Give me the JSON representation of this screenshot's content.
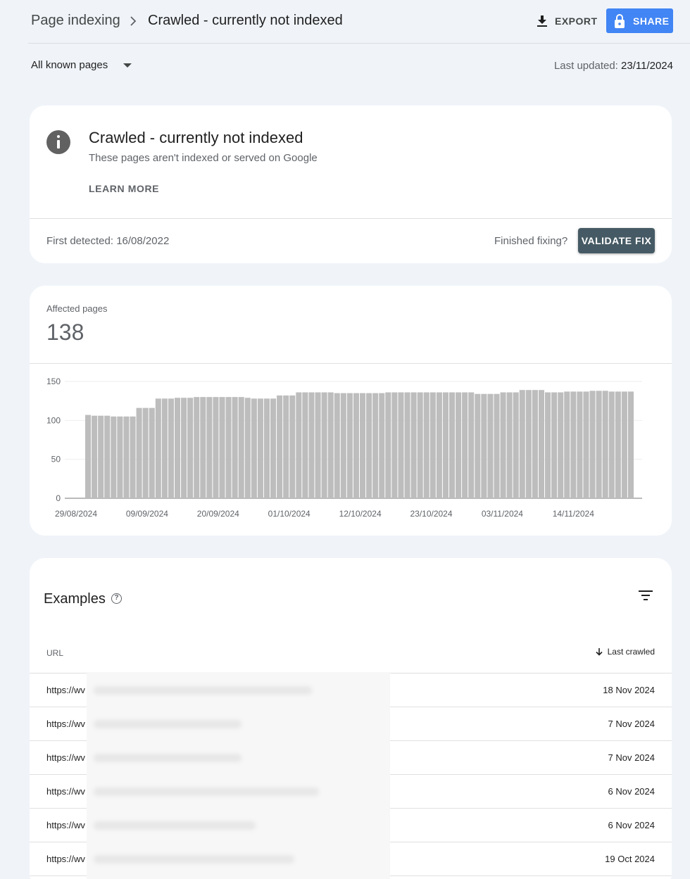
{
  "breadcrumb": {
    "root": "Page indexing",
    "current": "Crawled - currently not indexed"
  },
  "toolbar": {
    "export_label": "EXPORT",
    "share_label": "SHARE"
  },
  "filter": {
    "selected": "All known pages",
    "last_updated_label": "Last updated:",
    "last_updated_value": "23/11/2024"
  },
  "issue": {
    "title": "Crawled - currently not indexed",
    "description": "These pages aren't indexed or served on Google",
    "learn_more": "LEARN MORE",
    "first_detected": "First detected: 16/08/2022",
    "finished_fixing": "Finished fixing?",
    "validate_label": "VALIDATE FIX"
  },
  "affected": {
    "label": "Affected pages",
    "value": "138"
  },
  "chart_data": {
    "type": "bar",
    "title": "",
    "xlabel": "",
    "ylabel": "",
    "ylim": [
      0,
      150
    ],
    "yticks": [
      0,
      50,
      100,
      150
    ],
    "grid": true,
    "xtick_labels": [
      "29/08/2024",
      "09/09/2024",
      "20/09/2024",
      "01/10/2024",
      "12/10/2024",
      "23/10/2024",
      "03/11/2024",
      "14/11/2024"
    ],
    "color": "#bdbdbd",
    "series": [
      {
        "values": [
          107,
          106,
          106,
          106,
          105,
          105,
          105,
          105,
          116,
          116,
          116,
          128,
          128,
          128,
          129,
          129,
          129,
          130,
          130,
          130,
          130,
          130,
          130,
          130,
          130,
          129,
          128,
          128,
          128,
          128,
          132,
          132,
          132,
          136,
          136,
          136,
          136,
          136,
          136,
          135,
          135,
          135,
          135,
          135,
          135,
          135,
          135,
          136,
          136,
          136,
          136,
          136,
          136,
          136,
          136,
          136,
          136,
          136,
          136,
          136,
          136,
          134,
          134,
          134,
          134,
          136,
          136,
          136,
          139,
          139,
          139,
          139,
          136,
          136,
          136,
          137,
          137,
          137,
          137,
          138,
          138,
          138,
          137,
          137,
          137,
          137
        ]
      }
    ]
  },
  "examples": {
    "title": "Examples",
    "help_icon": "help-circle-icon",
    "filter_icon": "filter-list-icon",
    "col_url": "URL",
    "col_last_crawled": "Last crawled",
    "rows": [
      {
        "url": "https://wv",
        "date": "18 Nov 2024"
      },
      {
        "url": "https://wv",
        "date": "7 Nov 2024"
      },
      {
        "url": "https://wv",
        "date": "7 Nov 2024"
      },
      {
        "url": "https://wv",
        "date": "6 Nov 2024"
      },
      {
        "url": "https://wv",
        "date": "6 Nov 2024"
      },
      {
        "url": "https://wv",
        "date": "19 Oct 2024"
      }
    ]
  }
}
